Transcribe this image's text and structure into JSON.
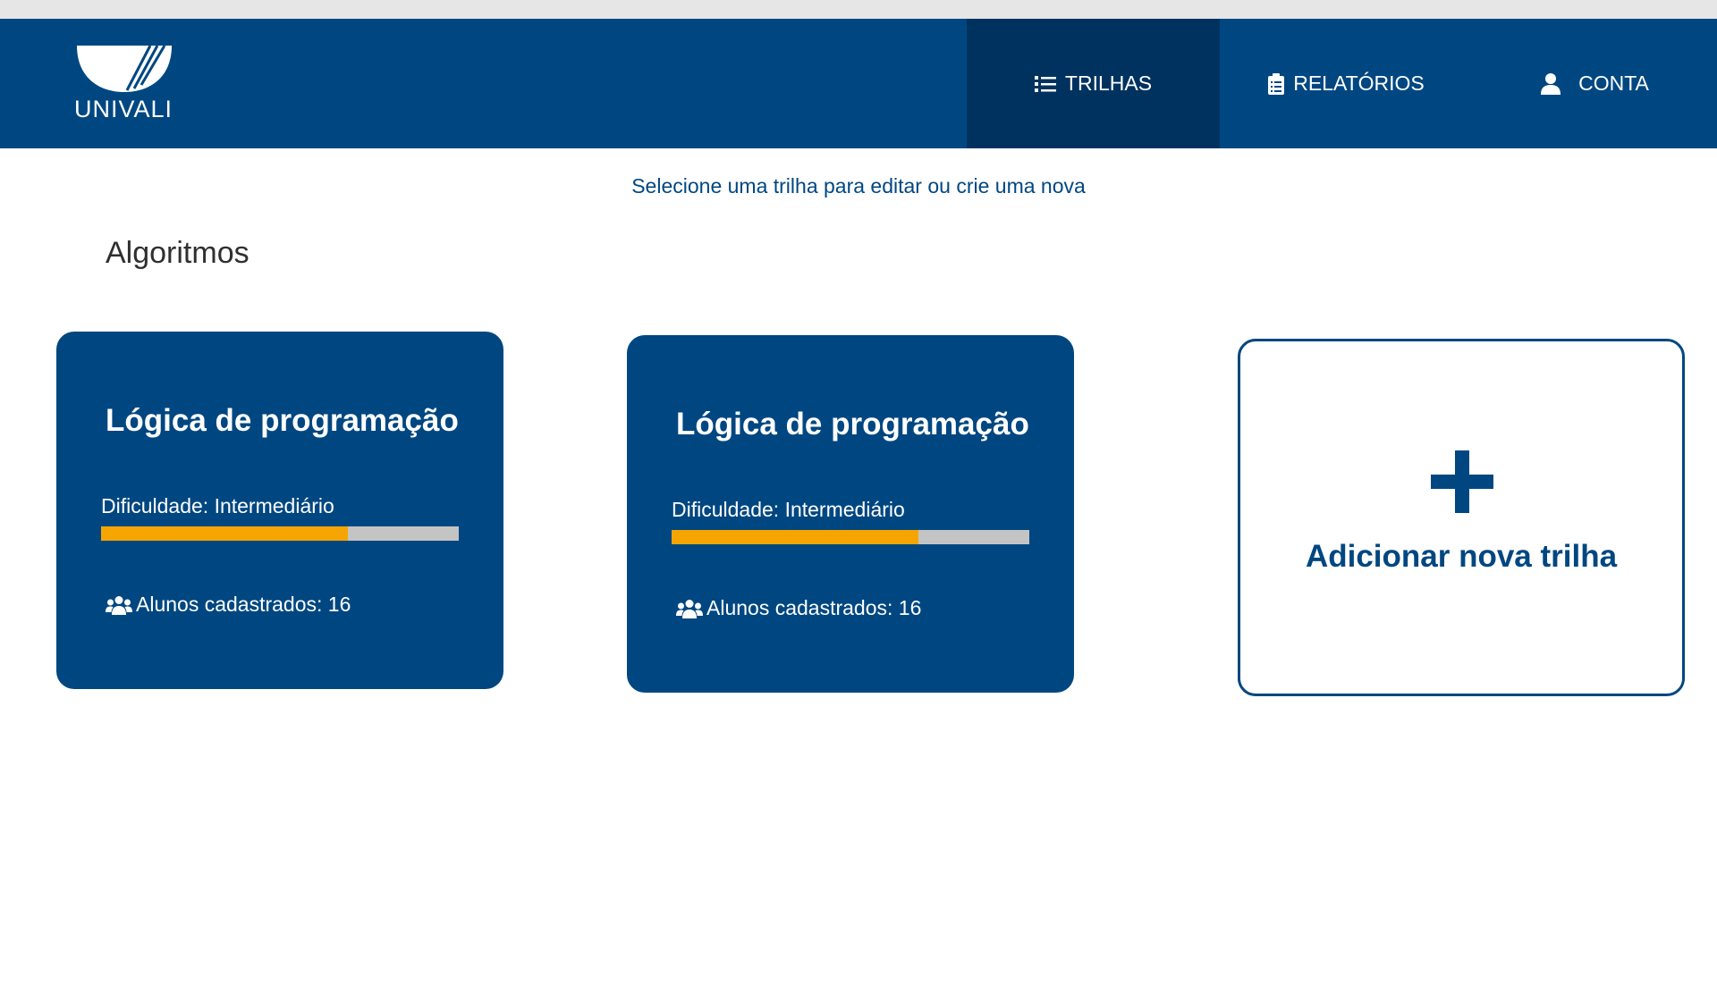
{
  "brand": {
    "logo_text": "UNIVALI",
    "primary_color": "#004781",
    "active_nav_color": "#003260",
    "accent_color": "#f6a500"
  },
  "nav": {
    "items": [
      {
        "label": "TRILHAS",
        "icon": "list-icon",
        "active": true
      },
      {
        "label": "RELATÓRIOS",
        "icon": "clipboard-icon",
        "active": false
      },
      {
        "label": "CONTA",
        "icon": "user-icon",
        "active": false
      }
    ]
  },
  "main": {
    "subtitle": "Selecione uma trilha para editar ou crie uma nova",
    "section_title": "Algoritmos",
    "cards": [
      {
        "title": "Lógica de programação",
        "difficulty": "Dificuldade: Intermediário",
        "difficulty_level": 0.69,
        "students": "Alunos cadastrados: 16",
        "students_icon": "users-icon"
      },
      {
        "title": "Lógica de programação",
        "difficulty": "Dificuldade: Intermediário",
        "difficulty_level": 0.69,
        "students": "Alunos cadastrados: 16",
        "students_icon": "users-icon"
      }
    ],
    "add_card": {
      "label": "Adicionar nova trilha",
      "icon": "plus-icon"
    }
  }
}
